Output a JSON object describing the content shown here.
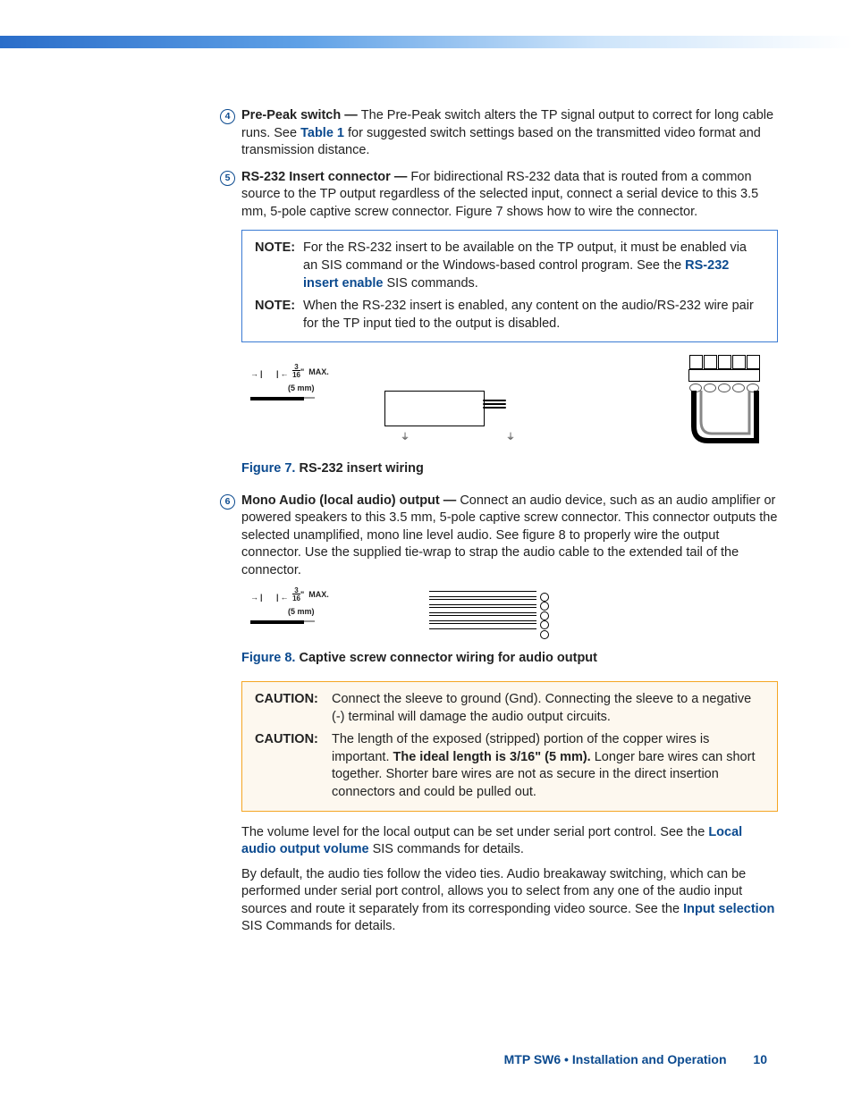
{
  "items": {
    "i4": {
      "num": "4",
      "head": "Pre-Peak switch — ",
      "body_a": "The Pre-Peak switch alters the TP signal output to correct for long cable runs.  See ",
      "link": "Table 1",
      "body_b": " for suggested switch settings based on the transmitted video format and transmission distance."
    },
    "i5": {
      "num": "5",
      "head": "RS-232 Insert connector — ",
      "body": "For bidirectional RS-232 data that is routed from a common source to the TP output regardless of the selected input, connect a serial device to this 3.5 mm, 5-pole captive screw connector.  Figure 7 shows how to wire the connector."
    },
    "i6": {
      "num": "6",
      "head": "Mono Audio (local audio) output — ",
      "body": "Connect an audio device, such as an audio amplifier or powered speakers to this 3.5 mm, 5-pole captive screw connector.  This connector outputs the selected unamplified, mono line level audio.  See figure 8 to properly wire the output connector.  Use the supplied tie-wrap to strap the audio cable to the extended tail of the connector."
    }
  },
  "notes": {
    "n1": {
      "tag": "NOTE:",
      "a": "For the RS-232 insert to be available on the TP output, it must be enabled via an SIS command or the Windows-based control program.  See the ",
      "link": "RS-232 insert enable",
      "b": " SIS commands."
    },
    "n2": {
      "tag": "NOTE:",
      "body": "When the RS-232 insert is enabled, any content on the audio/RS-232 wire pair for the TP input tied to the output is disabled."
    }
  },
  "cautions": {
    "c1": {
      "tag": "CAUTION:",
      "body": "Connect the sleeve to ground (Gnd).  Connecting the sleeve to a negative (-) terminal will damage the audio output circuits."
    },
    "c2": {
      "tag": "CAUTION:",
      "a": "The length of the exposed (stripped) portion of the copper wires is important.  ",
      "bold": "The ideal length is 3/16\" (5 mm).",
      "b": "  Longer bare wires can short together.  Shorter bare wires are not as secure in the direct insertion connectors and could be pulled out."
    }
  },
  "figcaps": {
    "f7": {
      "ref": "Figure 7.",
      "title": " RS-232 insert wiring"
    },
    "f8": {
      "ref": "Figure 8.",
      "title": " Captive screw connector wiring for audio output"
    }
  },
  "gauge": {
    "max": "MAX.",
    "mm": "(5 mm)",
    "num": "3",
    "den": "16",
    "inch": "\""
  },
  "para": {
    "p1a": "The volume level for the local output can be set under serial port control.  See the ",
    "p1link": "Local audio output volume",
    "p1b": " SIS commands for details.",
    "p2a": "By default, the audio ties follow the video ties.  Audio breakaway switching, which can be performed under serial port control, allows you to select from any one of the audio input sources and route it separately from its corresponding video source.  See the ",
    "p2link": "Input selection",
    "p2b": " SIS Commands for details."
  },
  "footer": {
    "text": "MTP SW6 • Installation and Operation",
    "page": "10"
  }
}
